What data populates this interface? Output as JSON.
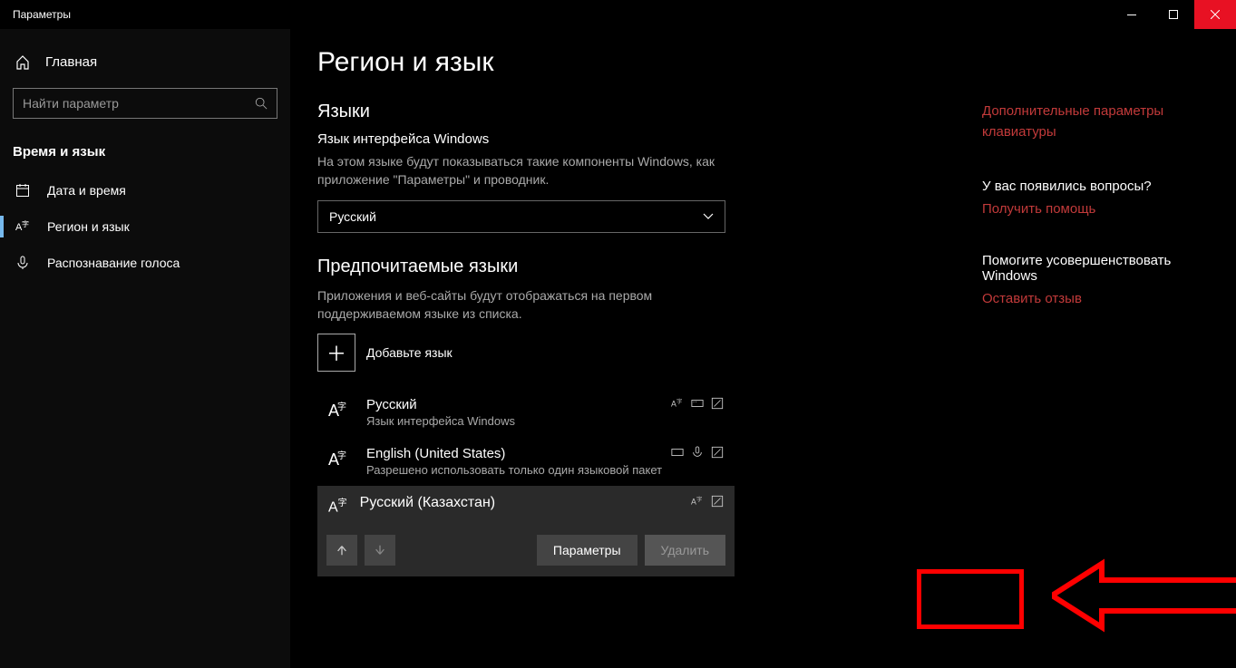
{
  "window": {
    "title": "Параметры"
  },
  "sidebar": {
    "home": "Главная",
    "search_placeholder": "Найти параметр",
    "category": "Время и язык",
    "items": [
      {
        "label": "Дата и время"
      },
      {
        "label": "Регион и язык"
      },
      {
        "label": "Распознавание голоса"
      }
    ]
  },
  "main": {
    "title": "Регион и язык",
    "sections": {
      "languages": "Языки",
      "ui_lang_label": "Язык интерфейса Windows",
      "ui_lang_desc": "На этом языке будут показываться такие компоненты Windows, как приложение \"Параметры\" и проводник.",
      "ui_lang_value": "Русский",
      "pref_langs": "Предпочитаемые языки",
      "pref_langs_desc": "Приложения и веб-сайты будут отображаться на первом поддерживаемом языке из списка.",
      "add_lang": "Добавьте язык"
    },
    "langs": [
      {
        "name": "Русский",
        "sub": "Язык интерфейса Windows"
      },
      {
        "name": "English (United States)",
        "sub": "Разрешено использовать только один языковой пакет"
      },
      {
        "name": "Русский (Казахстан)",
        "sub": ""
      }
    ],
    "buttons": {
      "params": "Параметры",
      "delete": "Удалить"
    }
  },
  "rail": {
    "link1": "Дополнительные параметры клавиатуры",
    "q": "У вас появились вопросы?",
    "help": "Получить помощь",
    "improve": "Помогите усовершенствовать Windows",
    "feedback": "Оставить отзыв"
  }
}
